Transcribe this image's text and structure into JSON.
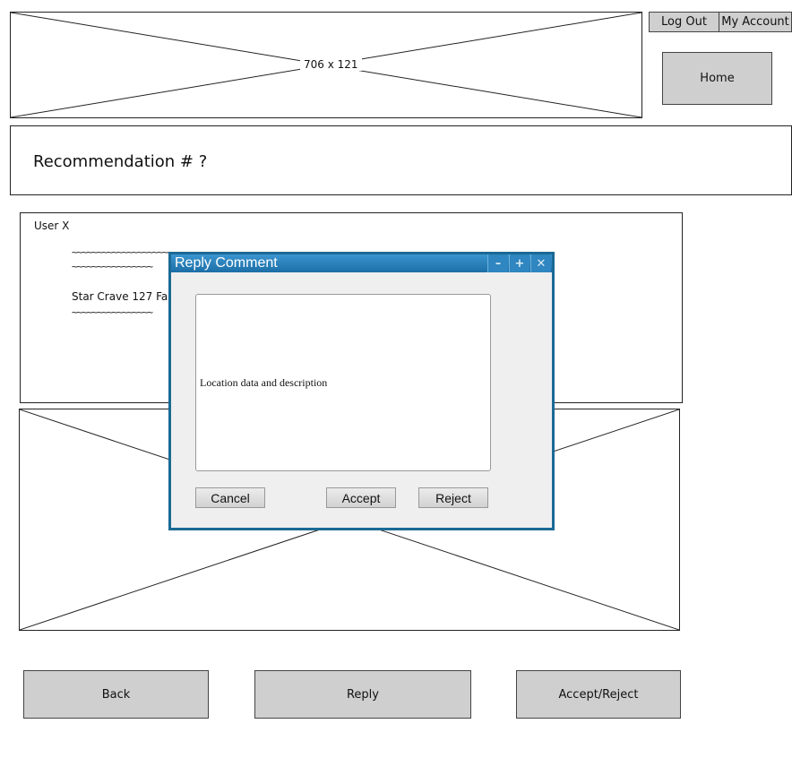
{
  "header": {
    "banner_placeholder": "706 x 121",
    "logout_label": "Log Out",
    "account_label": "My Account",
    "home_label": "Home"
  },
  "page": {
    "title": "Recommendation # ?"
  },
  "comment": {
    "user": "User X",
    "line1": "~~~~~~~~~~~~~~~~~~~~~~~~~~~~~~~~~~~~~~~~~~~~~~~~~~~~~~~~~~~~~~~~~~~~~~~~~~~~~~~~~~~~~~",
    "line2": "~~~~~~~~~~~~~~~~",
    "line3": "Star Crave 127 Fas",
    "line4": "~~~~~~~~~~~~~~~~"
  },
  "footer": {
    "back_label": "Back",
    "reply_label": "Reply",
    "accept_reject_label": "Accept/Reject"
  },
  "dialog": {
    "title": "Reply Comment",
    "text_value": "Location data and description",
    "cancel_label": "Cancel",
    "accept_label": "Accept",
    "reject_label": "Reject",
    "minimize_icon": "minimize-icon",
    "maximize_icon": "plus-icon",
    "close_icon": "close-icon"
  }
}
